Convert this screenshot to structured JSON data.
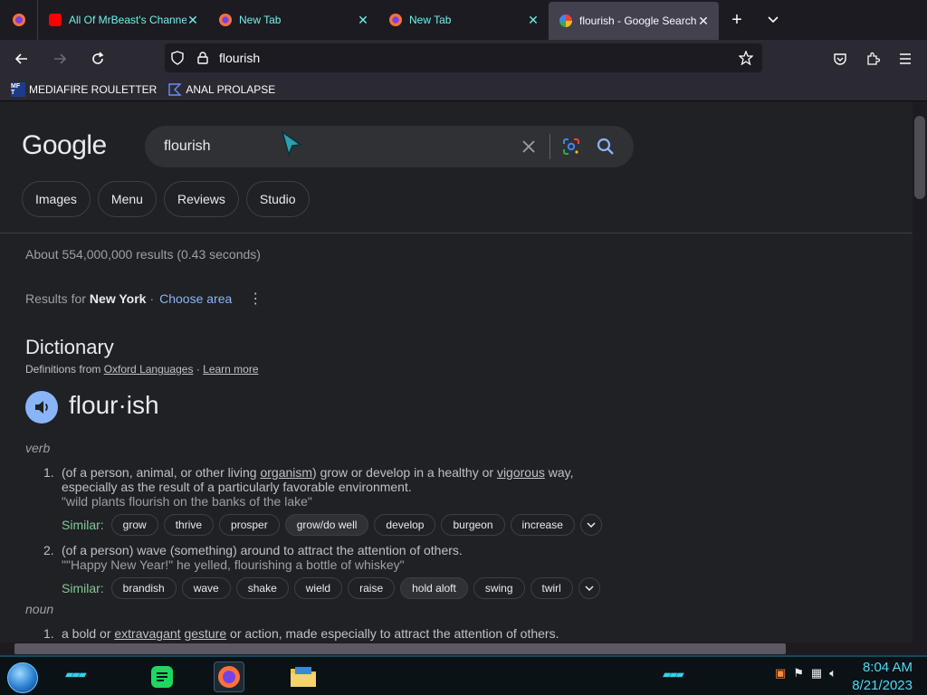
{
  "browser": {
    "tabs": [
      {
        "label": "All Of MrBeast's Channels",
        "icon": "youtube-icon",
        "active": false
      },
      {
        "label": "New Tab",
        "icon": "firefox-icon",
        "active": false
      },
      {
        "label": "New Tab",
        "icon": "firefox-icon",
        "active": false
      },
      {
        "label": "flourish - Google Search",
        "icon": "google-icon",
        "active": true
      }
    ],
    "url": "flourish",
    "bookmarks": [
      {
        "label": "MEDIAFIRE ROULETTER",
        "icon_text": "MF T"
      },
      {
        "label": "ANAL PROLAPSE"
      }
    ]
  },
  "google": {
    "logo": "Google",
    "query": "flourish",
    "chips": [
      "Images",
      "Menu",
      "Reviews",
      "Studio"
    ],
    "stats": "About 554,000,000 results (0.43 seconds)",
    "results_for_prefix": "Results for",
    "location": "New York",
    "separator": "·",
    "choose_area": "Choose area"
  },
  "dictionary": {
    "title": "Dictionary",
    "source_prefix": "Definitions from",
    "source_link": "Oxford Languages",
    "source_sep": "·",
    "learn_more": "Learn more",
    "word": "flour·ish",
    "verb_label": "verb",
    "noun_label": "noun",
    "similar_label": "Similar:",
    "def1": {
      "num": "1.",
      "p1": "(of a person, animal, or other living ",
      "u1": "organism",
      "p2": ") grow or develop in a healthy or ",
      "u2": "vigorous",
      "p3": " way, especially as the result of a particularly favorable environment.",
      "example": "\"wild plants flourish on the banks of the lake\"",
      "synonyms": [
        "grow",
        "thrive",
        "prosper",
        "grow/do well",
        "develop",
        "burgeon",
        "increase"
      ]
    },
    "def2": {
      "num": "2.",
      "text": "(of a person) wave (something) around to attract the attention of others.",
      "example": "\"\"Happy New Year!\" he yelled, flourishing a bottle of whiskey\"",
      "synonyms": [
        "brandish",
        "wave",
        "shake",
        "wield",
        "raise",
        "hold aloft",
        "swing",
        "twirl"
      ]
    },
    "def3": {
      "num": "1.",
      "p1": "a bold or ",
      "u1": "extravagant",
      "p2": " ",
      "u2": "gesture",
      "p3": " or action, made especially to attract the attention of others."
    }
  },
  "taskbar": {
    "time": "8:04 AM",
    "date": "8/21/2023"
  }
}
